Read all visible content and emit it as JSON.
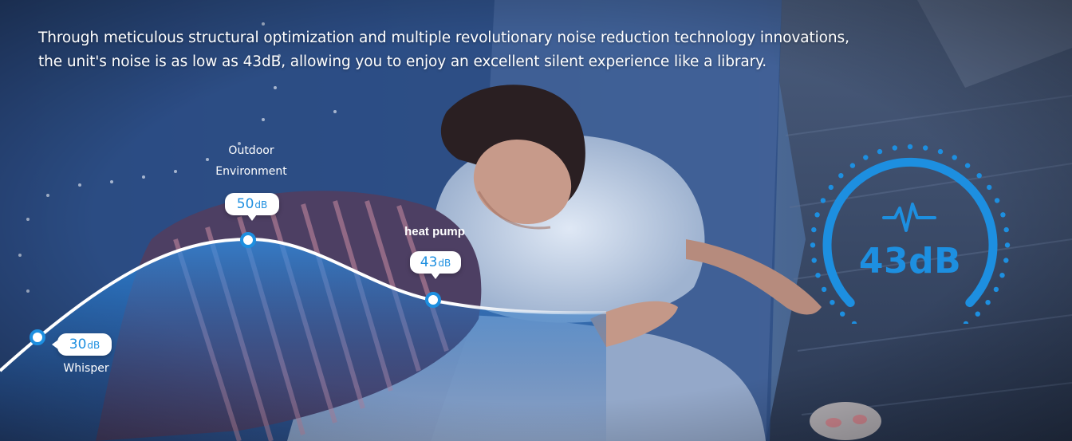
{
  "headline": {
    "line1": "Through meticulous structural optimization and multiple revolutionary noise reduction technology innovations,",
    "line2": "the unit's noise is as low as 43dB, allowing you to enjoy an excellent silent experience like a library."
  },
  "noise_points": [
    {
      "name": "Whisper",
      "number": "30",
      "unit": "dB"
    },
    {
      "name_line1": "Outdoor",
      "name_line2": "Environment",
      "number": "50",
      "unit": "dB"
    },
    {
      "name": "heat pump",
      "number": "43",
      "unit": "dB"
    }
  ],
  "gauge": {
    "value": "43dB",
    "icon": "heartbeat-pulse-icon"
  },
  "colors": {
    "accent": "#1d8fe0",
    "curve": "#ffffff",
    "bubble_bg": "#ffffff",
    "text": "#ffffff"
  }
}
